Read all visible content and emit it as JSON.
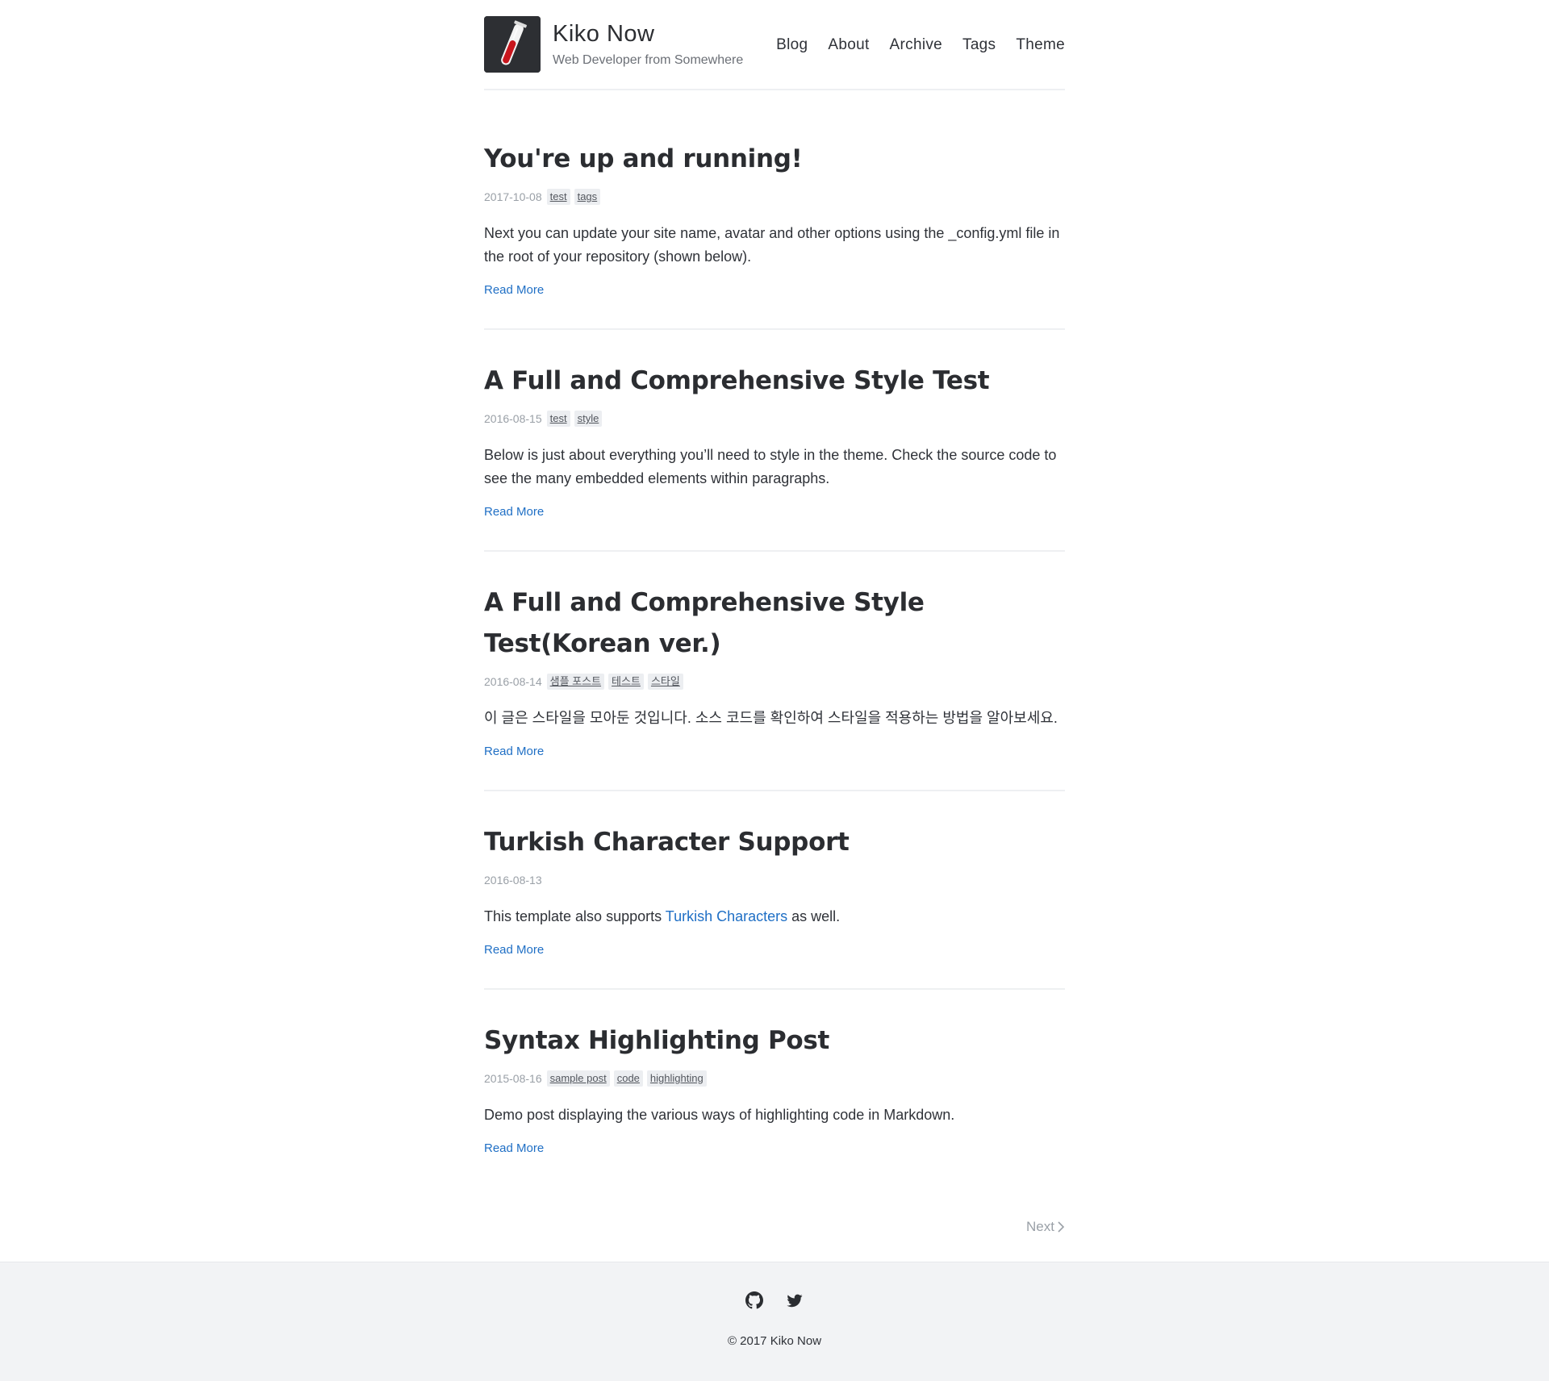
{
  "site": {
    "title": "Kiko Now",
    "description": "Web Developer from Somewhere",
    "avatar_icon": "test-tube-icon"
  },
  "nav": {
    "items": [
      {
        "label": "Blog"
      },
      {
        "label": "About"
      },
      {
        "label": "Archive"
      },
      {
        "label": "Tags"
      },
      {
        "label": "Theme"
      }
    ]
  },
  "posts": [
    {
      "title": "You're up and running!",
      "date": "2017-10-08",
      "tags": [
        "test",
        "tags"
      ],
      "excerpt": "Next you can update your site name, avatar and other options using the _config.yml file in the root of your repository (shown below).",
      "read_more": "Read More"
    },
    {
      "title": "A Full and Comprehensive Style Test",
      "date": "2016-08-15",
      "tags": [
        "test",
        "style"
      ],
      "excerpt": "Below is just about everything you’ll need to style in the theme. Check the source code to see the many embedded elements within paragraphs.",
      "read_more": "Read More"
    },
    {
      "title": "A Full and Comprehensive Style Test(Korean ver.)",
      "date": "2016-08-14",
      "tags": [
        "샘플 포스트",
        "테스트",
        "스타일"
      ],
      "excerpt": "이 글은 스타일을 모아둔 것입니다. 소스 코드를 확인하여 스타일을 적용하는 방법을 알아보세요.",
      "read_more": "Read More"
    },
    {
      "title": "Turkish Character Support",
      "date": "2016-08-13",
      "tags": [],
      "excerpt_before": "This template also supports ",
      "excerpt_link": "Turkish Characters",
      "excerpt_after": " as well.",
      "read_more": "Read More"
    },
    {
      "title": "Syntax Highlighting Post",
      "date": "2015-08-16",
      "tags": [
        "sample post",
        "code",
        "highlighting"
      ],
      "excerpt": "Demo post displaying the various ways of highlighting code in Markdown.",
      "read_more": "Read More"
    }
  ],
  "pagination": {
    "next_label": "Next",
    "next_icon": "chevron-right-icon"
  },
  "footer": {
    "social": [
      {
        "icon": "github-icon"
      },
      {
        "icon": "twitter-icon"
      }
    ],
    "copyright": "© 2017 Kiko Now"
  },
  "colors": {
    "link": "#1f6fc5",
    "text": "#2f3238",
    "muted": "#9aa0a7",
    "tag_bg": "#eceef1",
    "footer_bg": "#f2f3f5",
    "avatar_bg": "#2d2f33",
    "tube_liquid": "#c8161d"
  }
}
